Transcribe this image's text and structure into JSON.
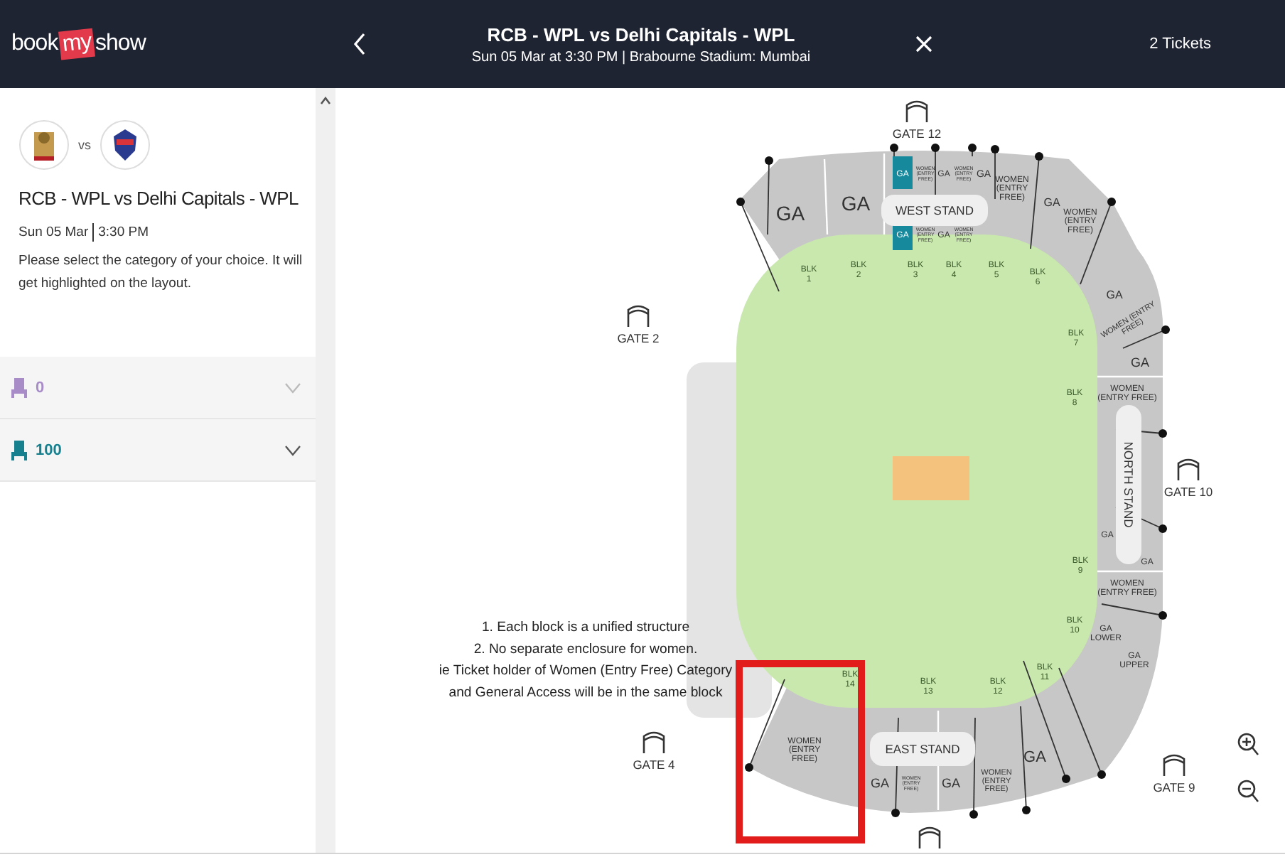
{
  "header": {
    "logo": [
      "book",
      "my",
      "show"
    ],
    "title": "RCB - WPL vs Delhi Capitals - WPL",
    "subtitle": "Sun 05 Mar at 3:30 PM | Brabourne Stadium: Mumbai",
    "tickets": "2 Tickets"
  },
  "event": {
    "vs": "vs",
    "title": "RCB - WPL vs Delhi Capitals - WPL",
    "date": "Sun 05 Mar",
    "time": "3:30 PM",
    "instructions": "Please select the category of your choice. It will get highlighted on the layout."
  },
  "categories": [
    {
      "count": "0",
      "color": "#a88cc8"
    },
    {
      "count": "100",
      "color": "#16808f"
    }
  ],
  "map": {
    "stands": [
      "WEST STAND",
      "NORTH STAND",
      "EAST STAND"
    ],
    "gates": [
      "GATE 12",
      "GATE 2",
      "GATE 10",
      "GATE 4",
      "GATE 9"
    ],
    "blocks": [
      [
        "BLK",
        "1"
      ],
      [
        "BLK",
        "2"
      ],
      [
        "BLK",
        "3"
      ],
      [
        "BLK",
        "4"
      ],
      [
        "BLK",
        "5"
      ],
      [
        "BLK",
        "6"
      ],
      [
        "BLK",
        "7"
      ],
      [
        "BLK",
        "8"
      ],
      [
        "BLK",
        "9"
      ],
      [
        "BLK",
        "10"
      ],
      [
        "BLK",
        "11"
      ],
      [
        "BLK",
        "12"
      ],
      [
        "BLK",
        "13"
      ],
      [
        "BLK",
        "14"
      ]
    ],
    "sections": [
      {
        "lines": [
          "GA"
        ],
        "highlighted": false
      },
      {
        "lines": [
          "GA"
        ],
        "highlighted": false
      },
      {
        "lines": [
          "GA"
        ],
        "highlighted": true
      },
      {
        "lines": [
          "WOMEN",
          "(ENTRY",
          "FREE)"
        ],
        "highlighted": false
      },
      {
        "lines": [
          "GA"
        ],
        "highlighted": false
      },
      {
        "lines": [
          "WOMEN",
          "(ENTRY",
          "FREE)"
        ],
        "highlighted": false
      },
      {
        "lines": [
          "GA"
        ],
        "highlighted": false
      },
      {
        "lines": [
          "WOMEN",
          "(ENTRY",
          "FREE)"
        ],
        "highlighted": false
      },
      {
        "lines": [
          "GA"
        ],
        "highlighted": false
      },
      {
        "lines": [
          "WOMEN",
          "(ENTRY",
          "FREE)"
        ],
        "highlighted": false
      },
      {
        "lines": [
          "GA"
        ],
        "highlighted": true
      },
      {
        "lines": [
          "WOMEN",
          "(ENTRY",
          "FREE)"
        ],
        "highlighted": false
      },
      {
        "lines": [
          "GA"
        ],
        "highlighted": false
      },
      {
        "lines": [
          "WOMEN",
          "(ENTRY",
          "FREE)"
        ],
        "highlighted": false
      },
      {
        "lines": [
          "GA"
        ],
        "highlighted": false
      },
      {
        "lines": [
          "WOMEN (ENTRY",
          "FREE)"
        ],
        "highlighted": false
      },
      {
        "lines": [
          "GA"
        ],
        "highlighted": false
      },
      {
        "lines": [
          "WOMEN",
          "(ENTRY FREE)"
        ],
        "highlighted": false
      },
      {
        "lines": [
          "GA"
        ],
        "highlighted": false
      },
      {
        "lines": [
          "GA"
        ],
        "highlighted": false
      },
      {
        "lines": [
          "WOMEN",
          "(ENTRY FREE)"
        ],
        "highlighted": false
      },
      {
        "lines": [
          "GA",
          "LOWER"
        ],
        "highlighted": false
      },
      {
        "lines": [
          "GA",
          "UPPER"
        ],
        "highlighted": false
      },
      {
        "lines": [
          "WOMEN",
          "(ENTRY",
          "FREE)"
        ],
        "highlighted": false
      },
      {
        "lines": [
          "GA"
        ],
        "highlighted": false
      },
      {
        "lines": [
          "WOMEN",
          "(ENTRY",
          "FREE)"
        ],
        "highlighted": false
      },
      {
        "lines": [
          "GA"
        ],
        "highlighted": false
      },
      {
        "lines": [
          "WOMEN",
          "(ENTRY",
          "FREE)"
        ],
        "highlighted": false
      },
      {
        "lines": [
          "GA"
        ],
        "highlighted": false
      }
    ],
    "notes": [
      "1. Each block is a unified structure",
      "2. No separate enclosure for women.",
      "ie Ticket holder of Women (Entry Free) Category",
      "and General Access will be in the same block"
    ]
  }
}
